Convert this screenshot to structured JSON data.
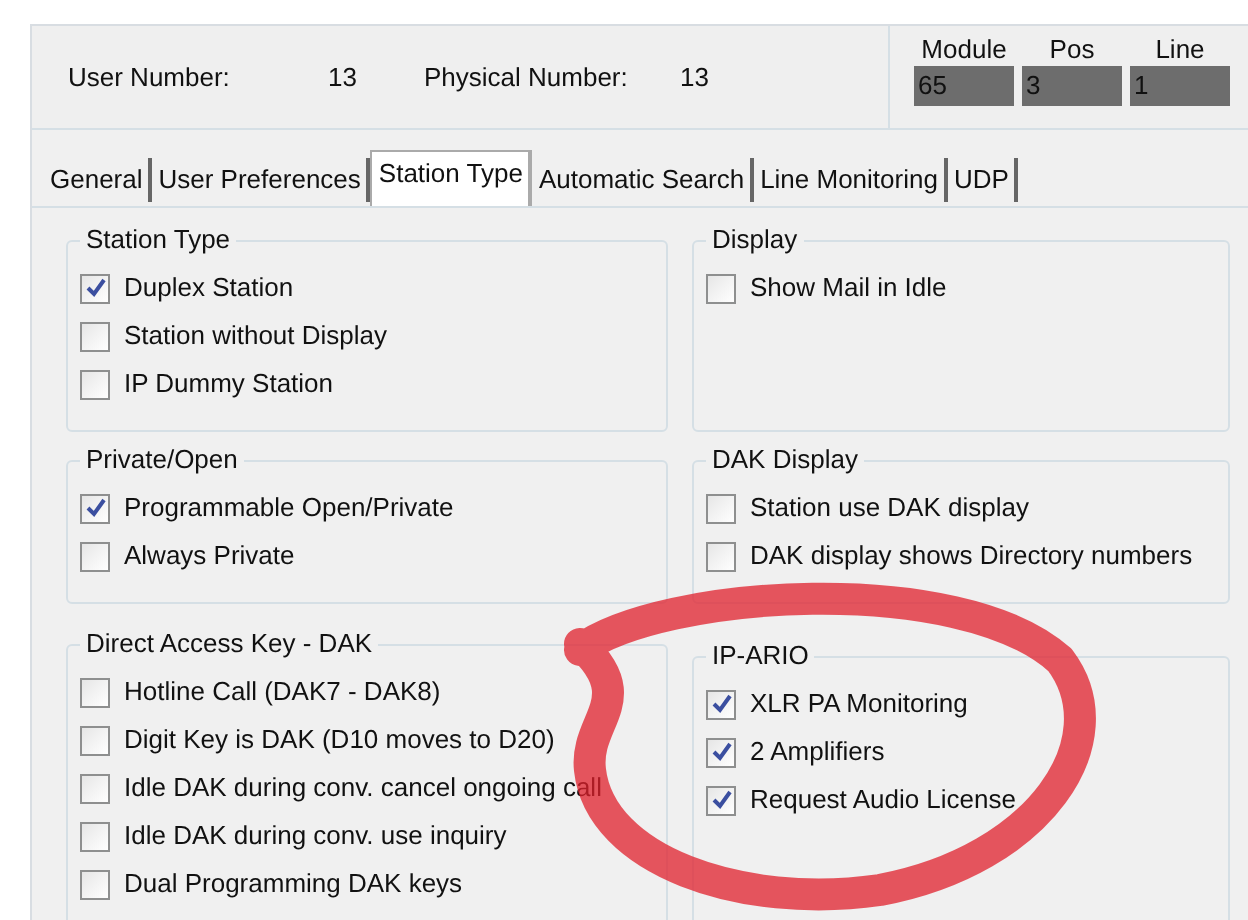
{
  "header": {
    "user_number_label": "User Number:",
    "user_number": "13",
    "physical_number_label": "Physical Number:",
    "physical_number": "13",
    "location": [
      {
        "label": "Module",
        "value": "65"
      },
      {
        "label": "Pos",
        "value": "3"
      },
      {
        "label": "Line",
        "value": "1"
      }
    ]
  },
  "tabs": [
    {
      "label": "General",
      "selected": false
    },
    {
      "label": "User Preferences",
      "selected": false
    },
    {
      "label": "Station Type",
      "selected": true
    },
    {
      "label": "Automatic Search",
      "selected": false
    },
    {
      "label": "Line Monitoring",
      "selected": false
    },
    {
      "label": "UDP",
      "selected": false
    }
  ],
  "groups": [
    {
      "title": "Station Type",
      "options": [
        {
          "label": "Duplex Station",
          "checked": true
        },
        {
          "label": "Station without Display",
          "checked": false
        },
        {
          "label": "IP Dummy Station",
          "checked": false
        }
      ]
    },
    {
      "title": "Display",
      "options": [
        {
          "label": "Show Mail in Idle",
          "checked": false
        }
      ]
    },
    {
      "title": "Private/Open",
      "options": [
        {
          "label": "Programmable Open/Private",
          "checked": true
        },
        {
          "label": "Always Private",
          "checked": false
        }
      ]
    },
    {
      "title": "DAK Display",
      "options": [
        {
          "label": "Station use DAK display",
          "checked": false
        },
        {
          "label": "DAK display shows Directory numbers",
          "checked": false
        }
      ]
    },
    {
      "title": "Direct Access Key - DAK",
      "options": [
        {
          "label": "Hotline Call (DAK7 - DAK8)",
          "checked": false
        },
        {
          "label": "Digit Key is DAK (D10 moves to D20)",
          "checked": false
        },
        {
          "label": "Idle DAK during conv. cancel ongoing call",
          "checked": false
        },
        {
          "label": "Idle DAK during conv. use inquiry",
          "checked": false
        },
        {
          "label": "Dual Programming DAK keys",
          "checked": false
        }
      ]
    },
    {
      "title": "IP-ARIO",
      "options": [
        {
          "label": "XLR PA Monitoring",
          "checked": true
        },
        {
          "label": "2 Amplifiers",
          "checked": true
        },
        {
          "label": "Request Audio License",
          "checked": true
        }
      ]
    }
  ]
}
